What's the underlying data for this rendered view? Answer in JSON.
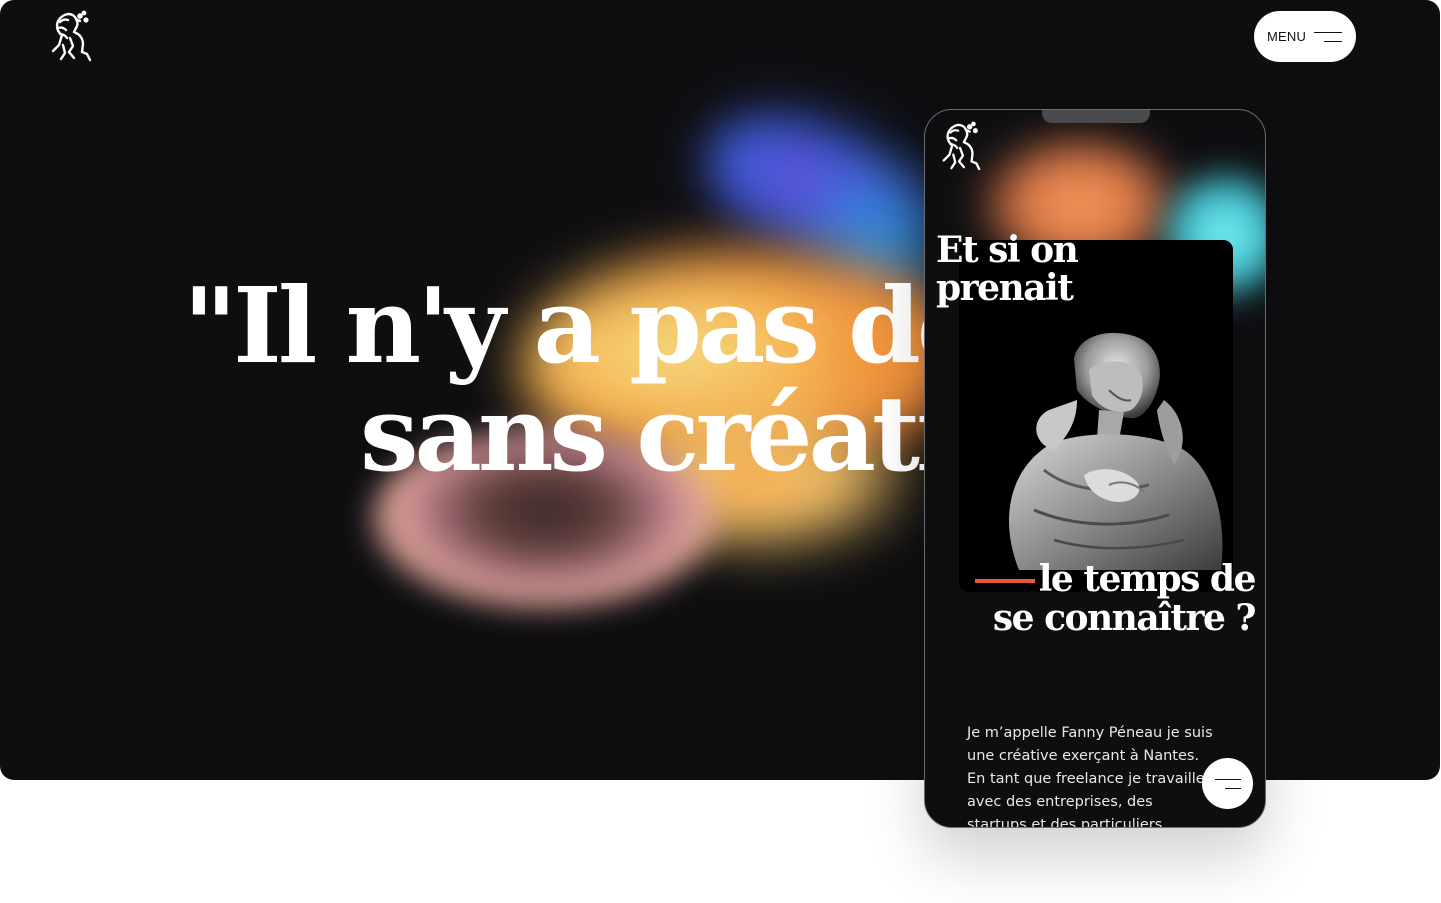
{
  "header": {
    "logo_icon": "lion-logo-icon",
    "menu_label": "MENU",
    "menu_icon": "hamburger-icon"
  },
  "hero": {
    "headline_line1": "\"Il n'y a pas de ri",
    "headline_line2": "sans créativ"
  },
  "phone": {
    "logo_icon": "lion-logo-icon",
    "title_part1": "Et si on prenait",
    "title_part2_line1": "le temps de",
    "title_part2_line2": "se connaître ?",
    "image_icon": "statue-photo",
    "bio": "Je m’appelle Fanny Péneau je suis une créative exerçant à Nantes. En tant que freelance je travaille avec des entreprises, des startups et des particuliers",
    "fab_icon": "hamburger-icon"
  },
  "colors": {
    "background": "#0e0e11",
    "accent": "#e5583a",
    "text": "#ffffff"
  }
}
